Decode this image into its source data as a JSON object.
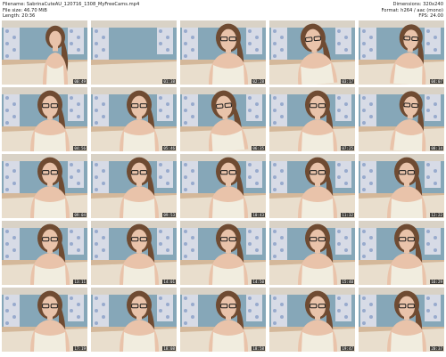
{
  "header": {
    "left": [
      "Filename: SabrinaCuteAU_120716_1308_MyFreeCams.mp4",
      "File size: 46.70 MiB",
      "Length: 20:36"
    ],
    "right": [
      "Dimensions: 320x240",
      "Format: h264 / aac (mono)",
      "FPS: 24.00"
    ]
  },
  "thumbnails": [
    {
      "time": "00:49",
      "variant": "A"
    },
    {
      "time": "01:38",
      "variant": "B"
    },
    {
      "time": "02:28",
      "variant": "C"
    },
    {
      "time": "03:17",
      "variant": "D"
    },
    {
      "time": "04:07",
      "variant": "E"
    },
    {
      "time": "04:56",
      "variant": "C"
    },
    {
      "time": "05:46",
      "variant": "C"
    },
    {
      "time": "06:35",
      "variant": "D"
    },
    {
      "time": "07:25",
      "variant": "C"
    },
    {
      "time": "08:14",
      "variant": "E"
    },
    {
      "time": "09:04",
      "variant": "C"
    },
    {
      "time": "09:53",
      "variant": "C"
    },
    {
      "time": "10:43",
      "variant": "C"
    },
    {
      "time": "11:32",
      "variant": "C"
    },
    {
      "time": "12:22",
      "variant": "C"
    },
    {
      "time": "13:11",
      "variant": "C"
    },
    {
      "time": "14:01",
      "variant": "C"
    },
    {
      "time": "14:50",
      "variant": "C"
    },
    {
      "time": "15:40",
      "variant": "C"
    },
    {
      "time": "16:29",
      "variant": "C"
    },
    {
      "time": "17:19",
      "variant": "C"
    },
    {
      "time": "18:08",
      "variant": "C"
    },
    {
      "time": "18:58",
      "variant": "C"
    },
    {
      "time": "19:47",
      "variant": "C"
    },
    {
      "time": "20:37",
      "variant": "C"
    }
  ],
  "colors": {
    "wall": "#86a7b8",
    "curtain": "#d7dbe6",
    "curtain_pattern": "#7d95c2",
    "ceiling": "#d9d2c6",
    "floor": "#d4b89a",
    "bed": "#ece4d6",
    "skin": "#e9c3aa",
    "hair": "#6f4b32",
    "top": "#f1eddf",
    "glasses": "#1b1b1b",
    "timestamp_bg": "#000000"
  }
}
